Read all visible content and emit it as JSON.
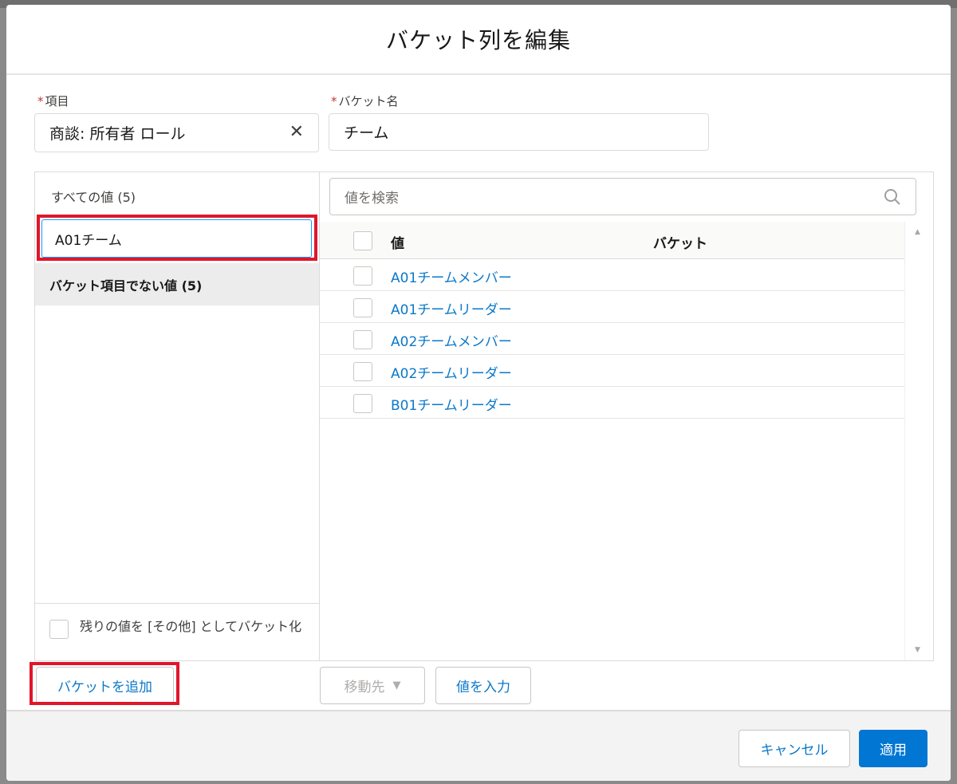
{
  "modal": {
    "title": "バケット列を編集"
  },
  "fields": {
    "item_label": "項目",
    "item_value": "商談: 所有者 ロール",
    "bucket_name_label": "バケット名",
    "bucket_name_value": "チーム",
    "required_mark": "*"
  },
  "left_panel": {
    "all_values": "すべての値 (5)",
    "bucket_edit_value": "A01チーム",
    "non_bucket": "バケット項目でない値 (5)",
    "remaining_label": "残りの値を [その他] としてバケット化"
  },
  "right_panel": {
    "search_placeholder": "値を検索",
    "columns": [
      "値",
      "バケット"
    ],
    "rows": [
      {
        "value": "A01チームメンバー",
        "bucket": ""
      },
      {
        "value": "A01チームリーダー",
        "bucket": ""
      },
      {
        "value": "A02チームメンバー",
        "bucket": ""
      },
      {
        "value": "A02チームリーダー",
        "bucket": ""
      },
      {
        "value": "B01チームリーダー",
        "bucket": ""
      }
    ]
  },
  "actions": {
    "add_bucket": "バケットを追加",
    "move_to": "移動先",
    "enter_value": "値を入力"
  },
  "footer": {
    "cancel": "キャンセル",
    "apply": "適用"
  },
  "colors": {
    "accent": "#0176d3",
    "link": "#0b78c9",
    "highlight": "#e0162b",
    "required": "#c23934"
  }
}
